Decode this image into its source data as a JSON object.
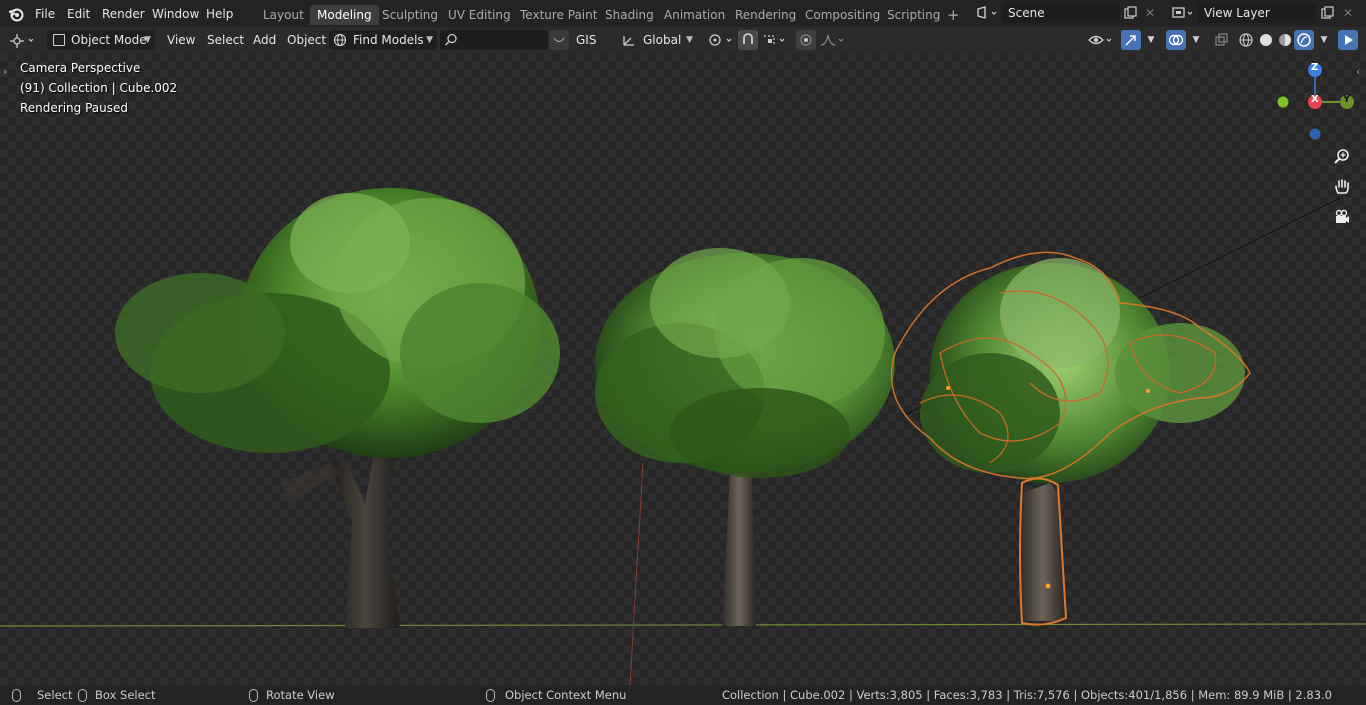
{
  "topbar": {
    "menus": [
      "File",
      "Edit",
      "Render",
      "Window",
      "Help"
    ],
    "workspaces": [
      "Layout",
      "Modeling",
      "Sculpting",
      "UV Editing",
      "Texture Paint",
      "Shading",
      "Animation",
      "Rendering",
      "Compositing",
      "Scripting"
    ],
    "active_workspace": "Modeling",
    "add_workspace": "+",
    "scene": "Scene",
    "view_layer": "View Layer"
  },
  "header": {
    "mode": "Object Mode",
    "view": "View",
    "select": "Select",
    "add": "Add",
    "object": "Object",
    "find_models": "Find Models",
    "search_value": "",
    "gis": "GIS",
    "orientation": "Global"
  },
  "viewport": {
    "perspective": "Camera Perspective",
    "collection_info": "(91) Collection | Cube.002",
    "render_status": "Rendering Paused",
    "gizmo": {
      "z": "Z",
      "x": "X",
      "y": "Y"
    }
  },
  "statusbar": {
    "select": "Select",
    "box_select": "Box Select",
    "rotate_view": "Rotate View",
    "context_menu": "Object Context Menu",
    "stats": "Collection | Cube.002 | Verts:3,805 | Faces:3,783 | Tris:7,576 | Objects:401/1,856 | Mem: 89.9 MiB | 2.83.0"
  },
  "colors": {
    "accent": "#4772b3",
    "selection_outline": "#e0782a",
    "axis_x": "#e8434f",
    "axis_y": "#8bb42d",
    "axis_z": "#3f7fe0"
  },
  "icons": {
    "blender_logo": "blender-logo-icon",
    "editor_type": "3d-viewport-icon",
    "zoom": "zoom-icon",
    "pan": "hand-icon",
    "camera": "camera-icon"
  }
}
